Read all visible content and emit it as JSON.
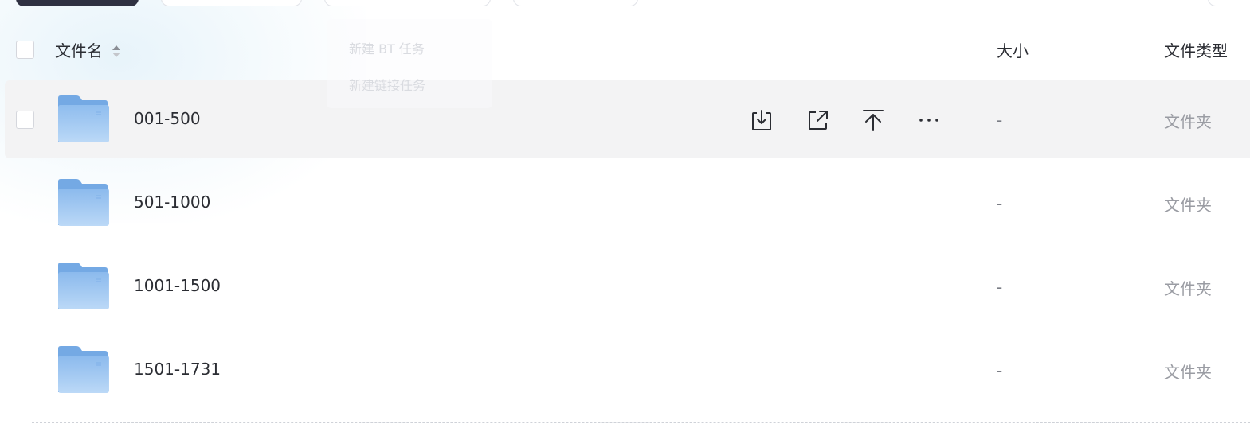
{
  "header": {
    "col_name": "文件名",
    "col_size": "大小",
    "col_type": "文件类型"
  },
  "dropdown": {
    "items": [
      "新建 BT 任务",
      "新建链接任务"
    ]
  },
  "files": [
    {
      "name": "001-500",
      "size": "-",
      "type": "文件夹"
    },
    {
      "name": "501-1000",
      "size": "-",
      "type": "文件夹"
    },
    {
      "name": "1001-1500",
      "size": "-",
      "type": "文件夹"
    },
    {
      "name": "1501-1731",
      "size": "-",
      "type": "文件夹"
    }
  ],
  "hovered_row": 0,
  "row_actions": [
    "download-icon",
    "share-external-icon",
    "pin-top-icon",
    "more-icon"
  ],
  "colors": {
    "toolbar_primary": "#2f3142",
    "row_hover": "#f3f3f4",
    "folder_blue": "#8cbcef",
    "text_primary": "#2b2d33",
    "text_muted": "#9a9ca3"
  }
}
